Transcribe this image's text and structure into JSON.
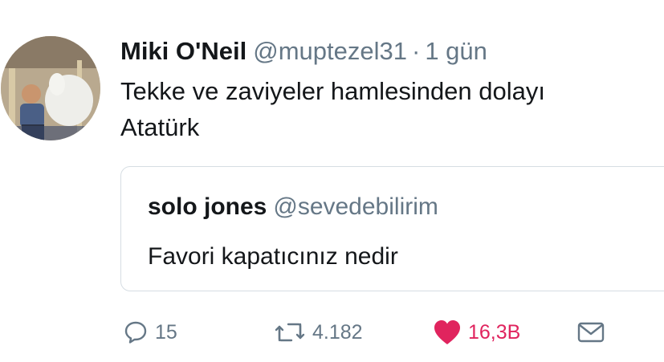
{
  "tweet": {
    "author_name": "Miki O'Neil",
    "author_handle": "@muptezel31",
    "separator": "·",
    "time": "1 gün",
    "text_lines": [
      "Tekke ve zaviyeler hamlesinden dolayı",
      "Atatürk"
    ]
  },
  "quoted_tweet": {
    "author_name": "solo jones",
    "author_handle": "@sevedebilirim",
    "text": "Favori kapatıcınız nedir"
  },
  "actions": {
    "reply_count": "15",
    "retweet_count": "4.182",
    "like_count": "16,3B",
    "reply_icon": "reply-icon",
    "retweet_icon": "retweet-icon",
    "like_icon": "heart-icon",
    "dm_icon": "envelope-icon"
  },
  "colors": {
    "text": "#14171a",
    "secondary": "#657786",
    "like": "#e0245e",
    "border": "#d6dde3"
  }
}
